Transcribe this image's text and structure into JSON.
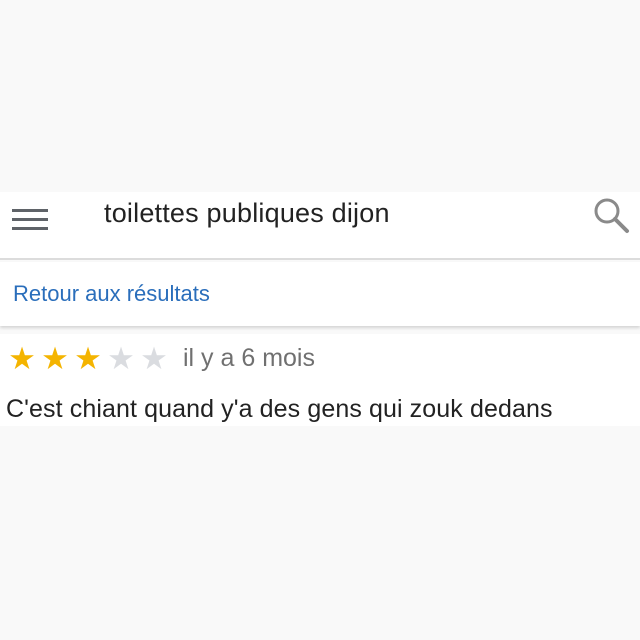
{
  "search": {
    "query": "toilettes publiques dijon",
    "menu_icon": "hamburger-menu-icon",
    "search_icon": "magnifier-icon"
  },
  "navigation": {
    "back_label": "Retour aux résultats"
  },
  "review": {
    "rating": 3,
    "max_rating": 5,
    "stars": [
      "★",
      "★",
      "★",
      "★",
      "★"
    ],
    "date": "il y a 6 mois",
    "text": "C'est chiant quand y'a des gens qui zouk dedans"
  },
  "colors": {
    "link": "#2a6ebb",
    "star_filled": "#f4b400",
    "star_empty": "#dadce0"
  }
}
